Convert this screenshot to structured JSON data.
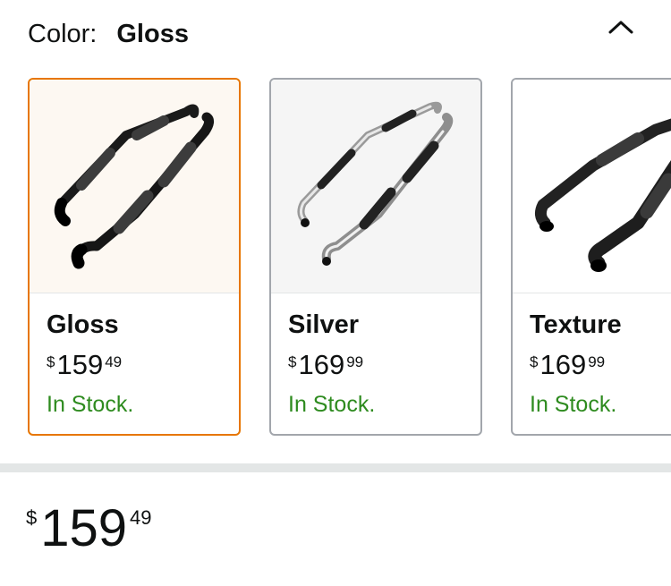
{
  "color_selector": {
    "label": "Color:",
    "selected_value": "Gloss",
    "toggle_icon": "chevron-up-icon"
  },
  "swatches": [
    {
      "name": "Gloss",
      "currency": "$",
      "price_whole": "159",
      "price_fraction": "49",
      "stock": "In Stock.",
      "selected": true
    },
    {
      "name": "Silver",
      "currency": "$",
      "price_whole": "169",
      "price_fraction": "99",
      "stock": "In Stock.",
      "selected": false
    },
    {
      "name": "Texture",
      "currency": "$",
      "price_whole": "169",
      "price_fraction": "99",
      "stock": "In Stock.",
      "selected": false
    }
  ],
  "price": {
    "currency": "$",
    "whole": "159",
    "fraction": "49"
  },
  "colors": {
    "selected_border": "#e77600",
    "default_border": "#a2a6ac",
    "stock_green": "#2e8b1f",
    "divider": "#e3e6e6"
  }
}
